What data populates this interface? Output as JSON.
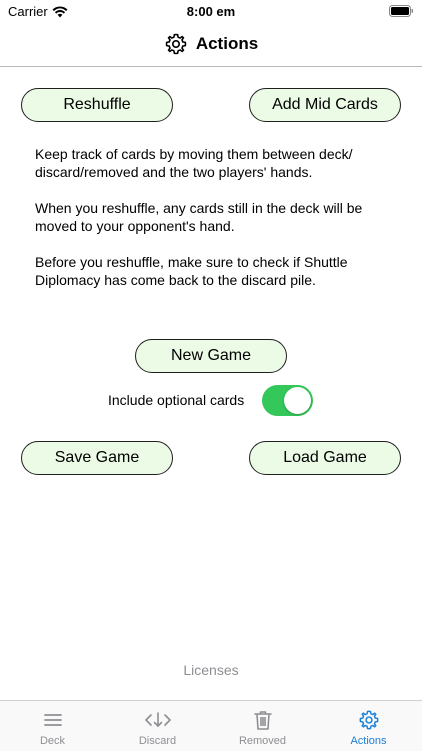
{
  "status_bar": {
    "carrier": "Carrier",
    "time": "8:00 em"
  },
  "header": {
    "title": "Actions",
    "icon": "gear-icon"
  },
  "buttons": {
    "reshuffle": "Reshuffle",
    "add_mid_cards": "Add Mid Cards",
    "new_game": "New Game",
    "save_game": "Save Game",
    "load_game": "Load Game"
  },
  "info": {
    "paragraphs": [
      "Keep track of cards by moving them between deck/ discard/removed and the two players' hands.",
      "When you reshuffle, any cards still in the deck will be moved to your opponent's hand.",
      "Before you reshuffle, make sure to check if Shuttle Diplomacy has come back to the discard pile."
    ]
  },
  "optional_cards": {
    "label": "Include optional cards",
    "enabled": true
  },
  "licenses": "Licenses",
  "tabs": [
    {
      "label": "Deck",
      "icon": "list-icon",
      "active": false
    },
    {
      "label": "Discard",
      "icon": "code-arrow-icon",
      "active": false
    },
    {
      "label": "Removed",
      "icon": "trash-icon",
      "active": false
    },
    {
      "label": "Actions",
      "icon": "gear-icon",
      "active": true
    }
  ],
  "colors": {
    "accent": "#1a7fd6",
    "button_fill": "#ecfbe6",
    "toggle_on": "#34c759"
  }
}
